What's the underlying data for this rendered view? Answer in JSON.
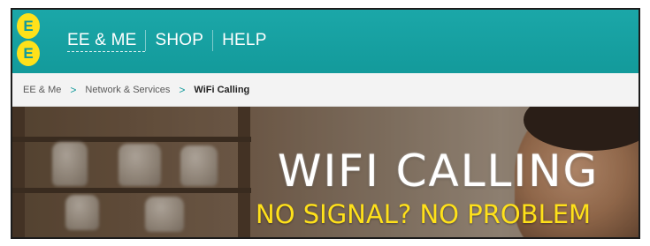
{
  "header": {
    "logo": {
      "letters": [
        "E",
        "E"
      ],
      "colors": {
        "logo": "#ffe11a",
        "bar": "#1ba7a8"
      }
    },
    "nav": [
      "EE & ME",
      "SHOP",
      "HELP"
    ]
  },
  "breadcrumb": {
    "items": [
      "EE & Me",
      "Network & Services",
      "WiFi Calling"
    ],
    "separator": ">"
  },
  "hero": {
    "title": "WIFI CALLING",
    "subtitle": "NO SIGNAL? NO PROBLEM",
    "colors": {
      "title": "#ffffff",
      "subtitle": "#ffe11a"
    }
  }
}
